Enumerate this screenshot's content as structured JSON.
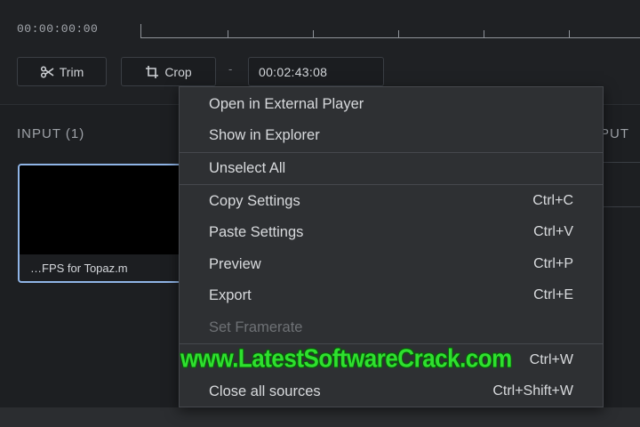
{
  "timeline": {
    "start_timecode": "00:00:00:00"
  },
  "toolbar": {
    "trim_label": "Trim",
    "crop_label": "Crop",
    "separator": "-",
    "duration_value": "00:02:43:08"
  },
  "input_panel": {
    "header": "INPUT (1)",
    "thumbnail_name": "…FPS for Topaz.m"
  },
  "output_panel": {
    "header_partial": "PUT"
  },
  "context_menu": {
    "items": [
      {
        "label": "Open in External Player",
        "shortcut": ""
      },
      {
        "label": "Show in Explorer",
        "shortcut": ""
      },
      {
        "label": "Unselect All",
        "shortcut": ""
      },
      {
        "label": "Copy Settings",
        "shortcut": "Ctrl+C"
      },
      {
        "label": "Paste Settings",
        "shortcut": "Ctrl+V"
      },
      {
        "label": "Preview",
        "shortcut": "Ctrl+P"
      },
      {
        "label": "Export",
        "shortcut": "Ctrl+E"
      },
      {
        "label": "Set Framerate",
        "shortcut": "",
        "disabled": true
      },
      {
        "label": "",
        "shortcut": "Ctrl+W"
      },
      {
        "label": "Close all sources",
        "shortcut": "Ctrl+Shift+W"
      }
    ]
  },
  "watermark": {
    "text": "www.LatestSoftwareCrack.com",
    "color": "#2ee02e"
  },
  "icons": [
    "scissors-icon",
    "crop-icon"
  ]
}
